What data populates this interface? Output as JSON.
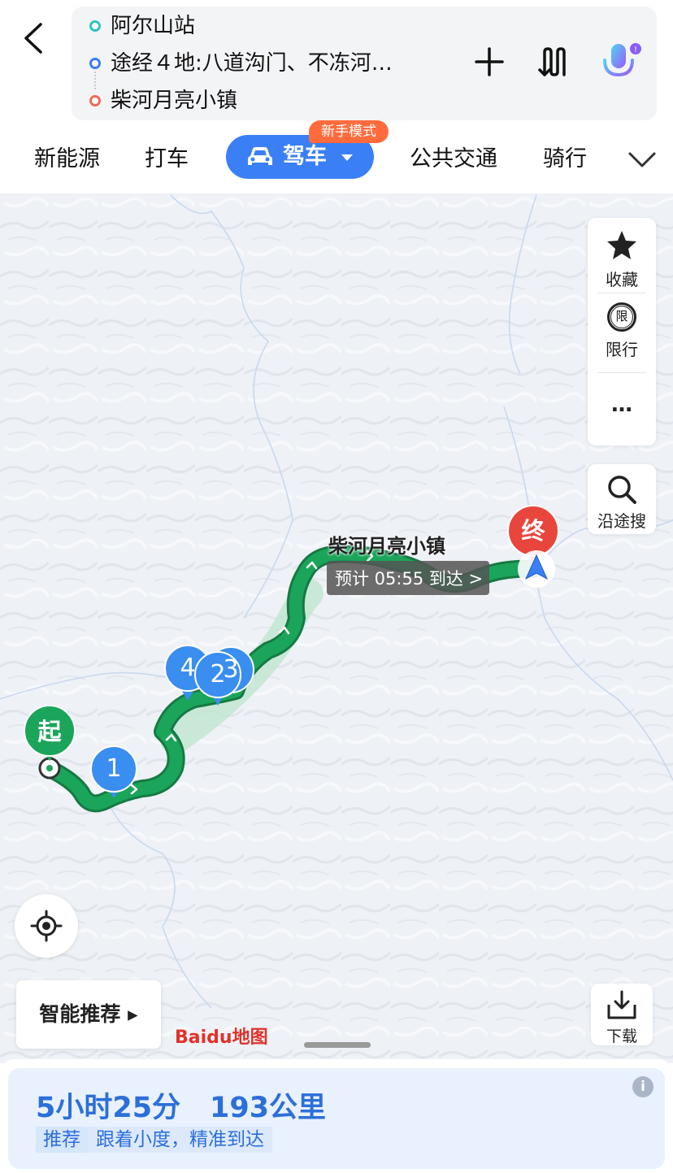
{
  "route": {
    "origin": "阿尔山站",
    "waypoints": "途经４地:八道沟门、不冻河…",
    "destination": "柴河月亮小镇"
  },
  "modes": {
    "new_energy": "新能源",
    "taxi": "打车",
    "drive": "驾车",
    "novice_badge": "新手模式",
    "transit": "公共交通",
    "cycling": "骑行"
  },
  "side_panel": {
    "favorite": "收藏",
    "restriction": "限行",
    "restriction_glyph": "限",
    "more": "…"
  },
  "search_along": "沿途搜",
  "map": {
    "start_marker": "起",
    "end_marker": "终",
    "waypoint_markers": [
      "1",
      "2",
      "3",
      "4"
    ],
    "destination_label": "柴河月亮小镇",
    "eta": "预计 05:55 到达 >",
    "watermark": "Baidu地图"
  },
  "smart_recommend": "智能推荐 ▸",
  "download": "下载",
  "summary": {
    "duration": "5小时25分",
    "distance": "193公里",
    "tag": "推荐",
    "slogan": "跟着小度，精准到达"
  },
  "colors": {
    "accent": "#3a7ff6",
    "route": "#1aa55a",
    "start": "#1aa55a",
    "end": "#e8453c",
    "badge": "#ff6b3d"
  }
}
